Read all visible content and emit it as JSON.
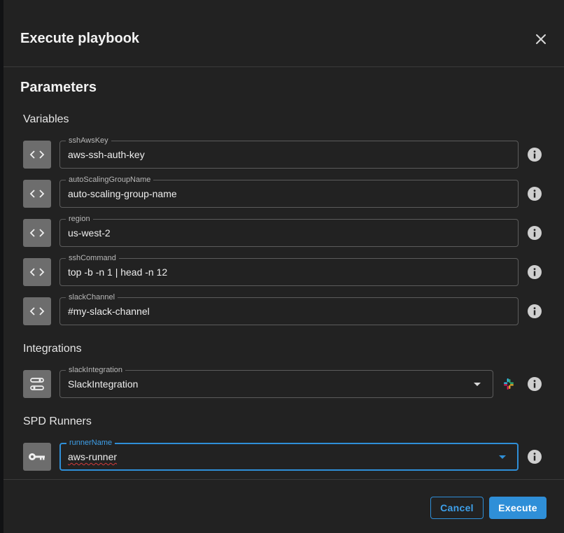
{
  "dialog": {
    "title": "Execute playbook",
    "section_title": "Parameters"
  },
  "groups": {
    "variables": "Variables",
    "integrations": "Integrations",
    "runners": "SPD Runners"
  },
  "variables": [
    {
      "label": "sshAwsKey",
      "value": "aws-ssh-auth-key",
      "icon": "code-icon"
    },
    {
      "label": "autoScalingGroupName",
      "value": "auto-scaling-group-name",
      "icon": "code-icon"
    },
    {
      "label": "region",
      "value": "us-west-2",
      "icon": "code-icon"
    },
    {
      "label": "sshCommand",
      "value": "top -b -n 1 | head -n 12",
      "icon": "code-icon"
    },
    {
      "label": "slackChannel",
      "value": "#my-slack-channel",
      "icon": "code-icon"
    }
  ],
  "integrations": [
    {
      "label": "slackIntegration",
      "value": "SlackIntegration",
      "icon": "integration-icon",
      "provider_icon": "slack-icon"
    }
  ],
  "runners": [
    {
      "label": "runnerName",
      "value": "aws-runner",
      "icon": "key-icon"
    }
  ],
  "footer": {
    "cancel_label": "Cancel",
    "execute_label": "Execute"
  },
  "colors": {
    "accent": "#2f8fd8",
    "background": "#222222",
    "icon_box": "#6d6d6d"
  }
}
